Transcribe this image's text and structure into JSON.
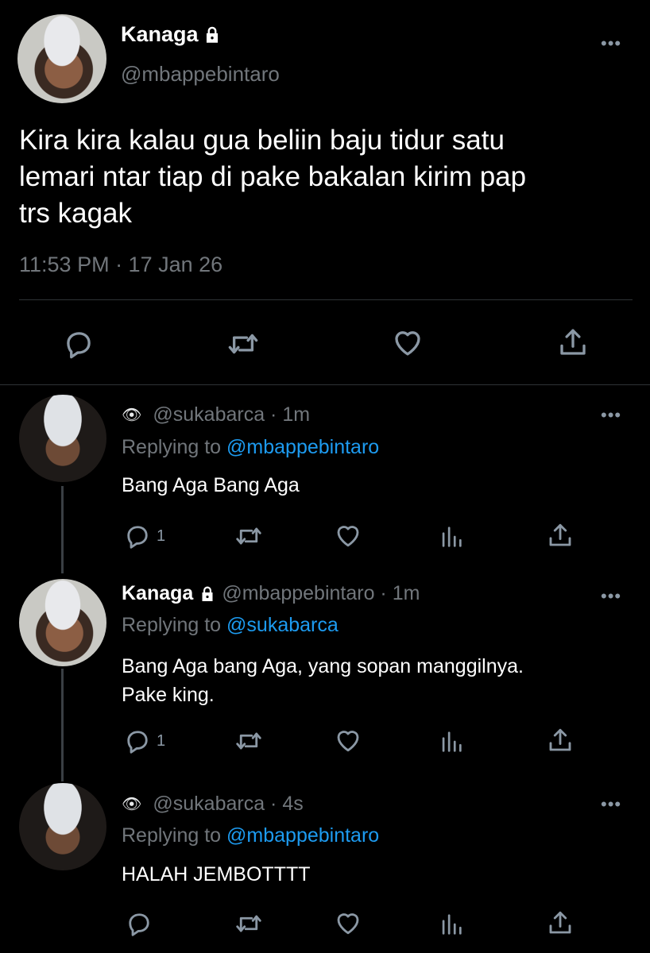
{
  "main_tweet": {
    "name": "Kanaga",
    "handle": "@mbappebintaro",
    "text_line1": "Kira kira kalau gua beliin baju tidur satu",
    "text_line2": "lemari ntar tiap di pake bakalan kirim pap",
    "text_line3": "trs kagak",
    "timestamp": "11:53 PM · 17 Jan 26",
    "icons": [
      "reply-icon",
      "retweet-icon",
      "like-icon",
      "share-icon"
    ]
  },
  "replies": [
    {
      "emoji": "👁",
      "handle_time": "@sukabarca · 1m",
      "replying_prefix": "Replying to",
      "replying_to": "@mbappebintaro",
      "text_line1": "Bang Aga Bang Aga",
      "reply_count": "1"
    },
    {
      "name": "Kanaga",
      "handle_time": "@mbappebintaro · 1m",
      "replying_prefix": "Replying to",
      "replying_to": "@sukabarca",
      "text_line1": "Bang Aga bang Aga, yang sopan manggilnya.",
      "text_line2": "Pake king.",
      "reply_count": "1"
    },
    {
      "emoji": "👁",
      "handle_time": "@sukabarca · 4s",
      "replying_prefix": "Replying to",
      "replying_to": "@mbappebintaro",
      "text_line1": "HALAH JEMBOTTTT"
    }
  ],
  "colors": {
    "background": "#000000",
    "text": "#e7e9ea",
    "muted": "#71767b",
    "link": "#1d9bf0",
    "divider": "#2f3336"
  }
}
